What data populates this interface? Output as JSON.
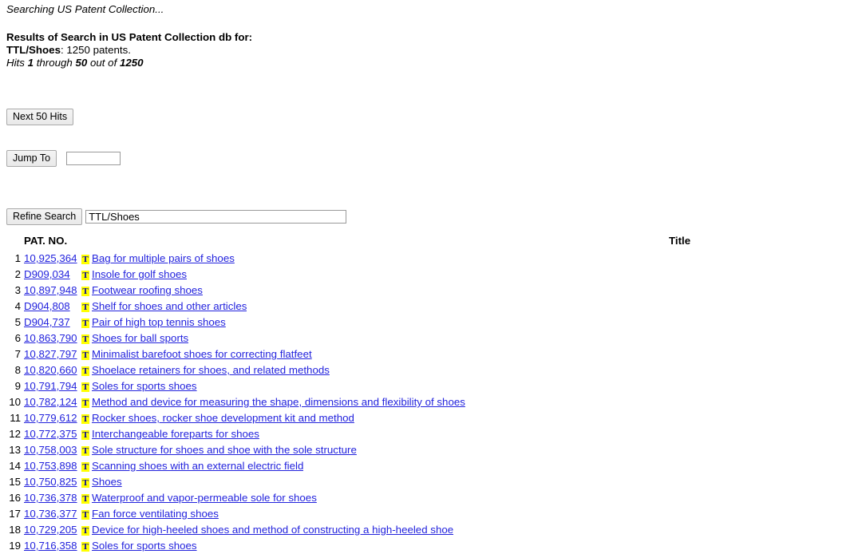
{
  "status": {
    "text": "Searching US Patent Collection..."
  },
  "results_header": {
    "line1": "Results of Search in US Patent Collection db for:",
    "query_label": "TTL/Shoes",
    "count_text": ": 1250 patents.",
    "hits_prefix": "Hits ",
    "hits_from": "1",
    "hits_mid": " through ",
    "hits_to": "50",
    "hits_suffix": " out of ",
    "hits_total": "1250"
  },
  "controls": {
    "next_label": "Next 50 Hits",
    "jump_label": "Jump To",
    "jump_value": "",
    "jump_placeholder": "",
    "refine_label": "Refine Search",
    "refine_value": "TTL/Shoes",
    "refine_placeholder": ""
  },
  "table": {
    "col_patno": "PAT. NO.",
    "col_title": "Title",
    "icon_name": "full-text-icon",
    "icon_glyph": "T",
    "rows": [
      {
        "num": "1",
        "patno": "10,925,364",
        "title": "Bag for multiple pairs of shoes"
      },
      {
        "num": "2",
        "patno": "D909,034",
        "title": "Insole for golf shoes"
      },
      {
        "num": "3",
        "patno": "10,897,948",
        "title": "Footwear roofing shoes"
      },
      {
        "num": "4",
        "patno": "D904,808",
        "title": "Shelf for shoes and other articles"
      },
      {
        "num": "5",
        "patno": "D904,737",
        "title": "Pair of high top tennis shoes"
      },
      {
        "num": "6",
        "patno": "10,863,790",
        "title": "Shoes for ball sports"
      },
      {
        "num": "7",
        "patno": "10,827,797",
        "title": "Minimalist barefoot shoes for correcting flatfeet"
      },
      {
        "num": "8",
        "patno": "10,820,660",
        "title": "Shoelace retainers for shoes, and related methods"
      },
      {
        "num": "9",
        "patno": "10,791,794",
        "title": "Soles for sports shoes"
      },
      {
        "num": "10",
        "patno": "10,782,124",
        "title": "Method and device for measuring the shape, dimensions and flexibility of shoes"
      },
      {
        "num": "11",
        "patno": "10,779,612",
        "title": "Rocker shoes, rocker shoe development kit and method"
      },
      {
        "num": "12",
        "patno": "10,772,375",
        "title": "Interchangeable foreparts for shoes"
      },
      {
        "num": "13",
        "patno": "10,758,003",
        "title": "Sole structure for shoes and shoe with the sole structure"
      },
      {
        "num": "14",
        "patno": "10,753,898",
        "title": "Scanning shoes with an external electric field"
      },
      {
        "num": "15",
        "patno": "10,750,825",
        "title": "Shoes"
      },
      {
        "num": "16",
        "patno": "10,736,378",
        "title": "Waterproof and vapor-permeable sole for shoes"
      },
      {
        "num": "17",
        "patno": "10,736,377",
        "title": "Fan force ventilating shoes"
      },
      {
        "num": "18",
        "patno": "10,729,205",
        "title": "Device for high-heeled shoes and method of constructing a high-heeled shoe"
      },
      {
        "num": "19",
        "patno": "10,716,358",
        "title": "Soles for sports shoes"
      }
    ]
  },
  "colors": {
    "link": "#2323dd",
    "icon_bg": "#ffff00",
    "icon_fg": "#00009f",
    "page_bg": "#ffffff"
  }
}
